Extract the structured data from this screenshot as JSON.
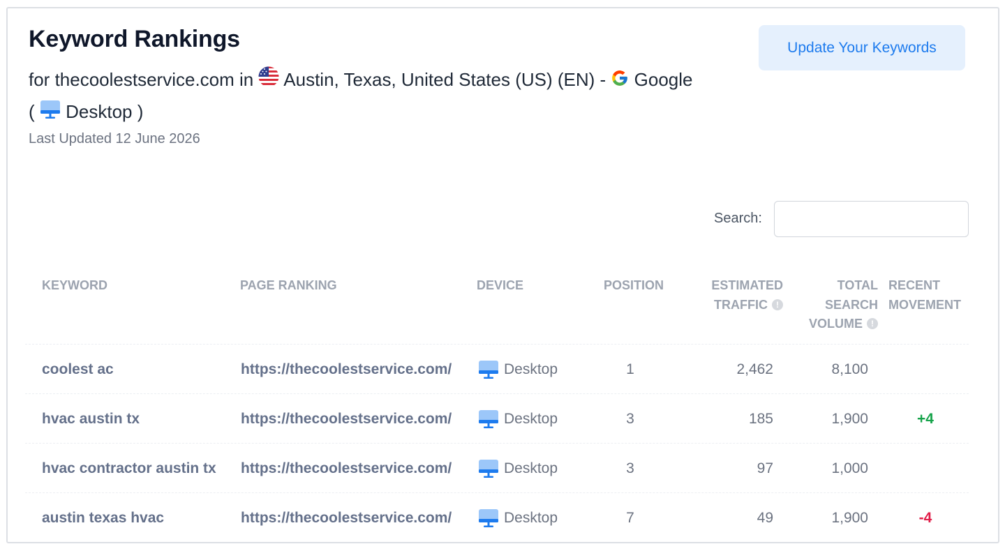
{
  "header": {
    "title": "Keyword Rankings",
    "subtitle_prefix": "for thecoolestservice.com in",
    "location": "Austin, Texas, United States (US) (EN) -",
    "engine": "Google",
    "device_open": "(",
    "device": "Desktop",
    "device_close": ")",
    "last_updated": "Last Updated 12 June 2026"
  },
  "actions": {
    "update_keywords_label": "Update Your Keywords"
  },
  "search": {
    "label": "Search:",
    "value": "",
    "placeholder": ""
  },
  "table": {
    "columns": {
      "keyword": "KEYWORD",
      "page_ranking": "PAGE RANKING",
      "device": "DEVICE",
      "position": "POSITION",
      "estimated_traffic_1": "ESTIMATED",
      "estimated_traffic_2": "TRAFFIC",
      "total_search_volume_1": "TOTAL",
      "total_search_volume_2": "SEARCH",
      "total_search_volume_3": "VOLUME",
      "recent_movement_1": "RECENT",
      "recent_movement_2": "MOVEMENT"
    },
    "rows": [
      {
        "keyword": "coolest ac",
        "page": "https://thecoolestservice.com/",
        "device": "Desktop",
        "position": "1",
        "traffic": "2,462",
        "volume": "8,100",
        "movement": ""
      },
      {
        "keyword": "hvac austin tx",
        "page": "https://thecoolestservice.com/",
        "device": "Desktop",
        "position": "3",
        "traffic": "185",
        "volume": "1,900",
        "movement": "+4"
      },
      {
        "keyword": "hvac contractor austin tx",
        "page": "https://thecoolestservice.com/",
        "device": "Desktop",
        "position": "3",
        "traffic": "97",
        "volume": "1,000",
        "movement": ""
      },
      {
        "keyword": "austin texas hvac",
        "page": "https://thecoolestservice.com/",
        "device": "Desktop",
        "position": "7",
        "traffic": "49",
        "volume": "1,900",
        "movement": "-4"
      }
    ]
  },
  "icons": {
    "flag": "us-flag-icon",
    "engine": "google-logo-icon",
    "device": "desktop-monitor-icon",
    "info": "info-icon"
  },
  "colors": {
    "accent": "#1d7bee",
    "button_bg": "#e5f0fd",
    "positive": "#16a34a",
    "negative": "#e11d48"
  }
}
